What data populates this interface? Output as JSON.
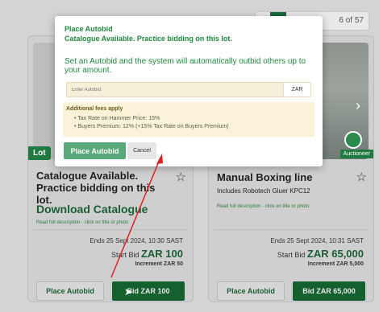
{
  "pager": {
    "text": "6 of 57"
  },
  "cards": [
    {
      "ribbon": "Lot",
      "title": "Catalogue Available. Practice bidding on this lot.",
      "download": "Download Catalogue",
      "readmore": "Read full description - click on title or photo",
      "ends": "Ends 25 Sept 2024, 10:30 SAST",
      "startbid_label": "Start Bid",
      "startbid_value": "ZAR 100",
      "increment": "Increment ZAR 50",
      "autobid_btn": "Place Autobid",
      "bid_btn": "Bid ZAR 100"
    },
    {
      "ribbon_right": "Auctioneer",
      "title": "Manual Boxing line",
      "subtitle": "Includes Robotech Gluer KPC12",
      "readmore": "Read full description - click on title or photo",
      "ends": "Ends 25 Sept 2024, 10:31 SAST",
      "startbid_label": "Start Bid",
      "startbid_value": "ZAR 65,000",
      "increment": "Increment ZAR 5,000",
      "autobid_btn": "Place Autobid",
      "bid_btn": "Bid ZAR 65,000"
    }
  ],
  "modal": {
    "title": "Place Autobid",
    "subtitle": "Catalogue Available. Practice bidding on this lot.",
    "description": "Set an Autobid and the system will automatically outbid others up to your amount.",
    "input_placeholder": "Enter Autobid",
    "input_value": "",
    "currency": "ZAR",
    "fees_title": "Additional fees apply",
    "fees": [
      "Tax Rate on Hammer Price: 15%",
      "Buyers Premium: 12% (+15% Tax Rate on Buyers Premium)"
    ],
    "place_btn": "Place Autobid",
    "cancel_btn": "Cancel"
  },
  "colors": {
    "brand_green": "#1a5e33",
    "accent_green": "#1f8a3d",
    "fee_bg": "#fbf3d9",
    "arrow_red": "#e02020"
  }
}
